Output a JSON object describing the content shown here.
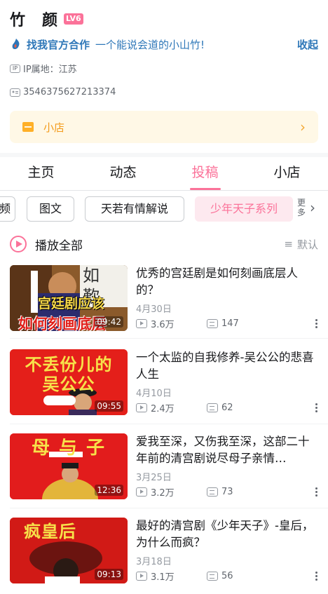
{
  "profile": {
    "username": "竹　颜",
    "level": "LV6",
    "official_title": "找我官方合作",
    "official_desc": "一个能说会道的小山竹!",
    "collapse_label": "收起",
    "ip_badge": "IP",
    "ip_location": "IP属地：江苏",
    "uid": "3546375627213374"
  },
  "shop": {
    "label": "小店"
  },
  "tabs": [
    "主页",
    "动态",
    "投稿",
    "小店"
  ],
  "active_tab": "投稿",
  "chips": [
    "频",
    "图文",
    "天若有情解说",
    "少年天子系列"
  ],
  "active_chip": "少年天子系列",
  "chips_more": "更多",
  "play_all": "播放全部",
  "sort_label": "默认",
  "videos": [
    {
      "title": "优秀的宫廷剧是如何刻画底层人的？",
      "date": "4月30日",
      "views": "3.6万",
      "danmaku": "147",
      "duration": "09:42",
      "thumb_text_top": "宫廷剧应该",
      "thumb_text_bottom": "如何刻画底层",
      "thumb_corner": "如 歎"
    },
    {
      "title": "一个太监的自我修养-吴公公的悲喜人生",
      "date": "4月10日",
      "views": "2.4万",
      "danmaku": "62",
      "duration": "09:55",
      "thumb_text_top": "不丢份儿的",
      "thumb_text_bottom": "吴公公"
    },
    {
      "title": "爱我至深，又伤我至深，这部二十年前的清宫剧说尽母子亲情…",
      "date": "3月25日",
      "views": "3.2万",
      "danmaku": "73",
      "duration": "12:36",
      "thumb_text_top": "母 与 子"
    },
    {
      "title": "最好的清宫剧《少年天子》-皇后，为什么而疯？",
      "date": "3月18日",
      "views": "3.1万",
      "danmaku": "56",
      "duration": "09:13",
      "thumb_text_top": "疯皇后"
    }
  ],
  "colors": {
    "accent_pink": "#fb7299",
    "official_blue": "#2e77b8",
    "shop_yellow": "#ffb027",
    "thumb_red": "#e0201a"
  }
}
